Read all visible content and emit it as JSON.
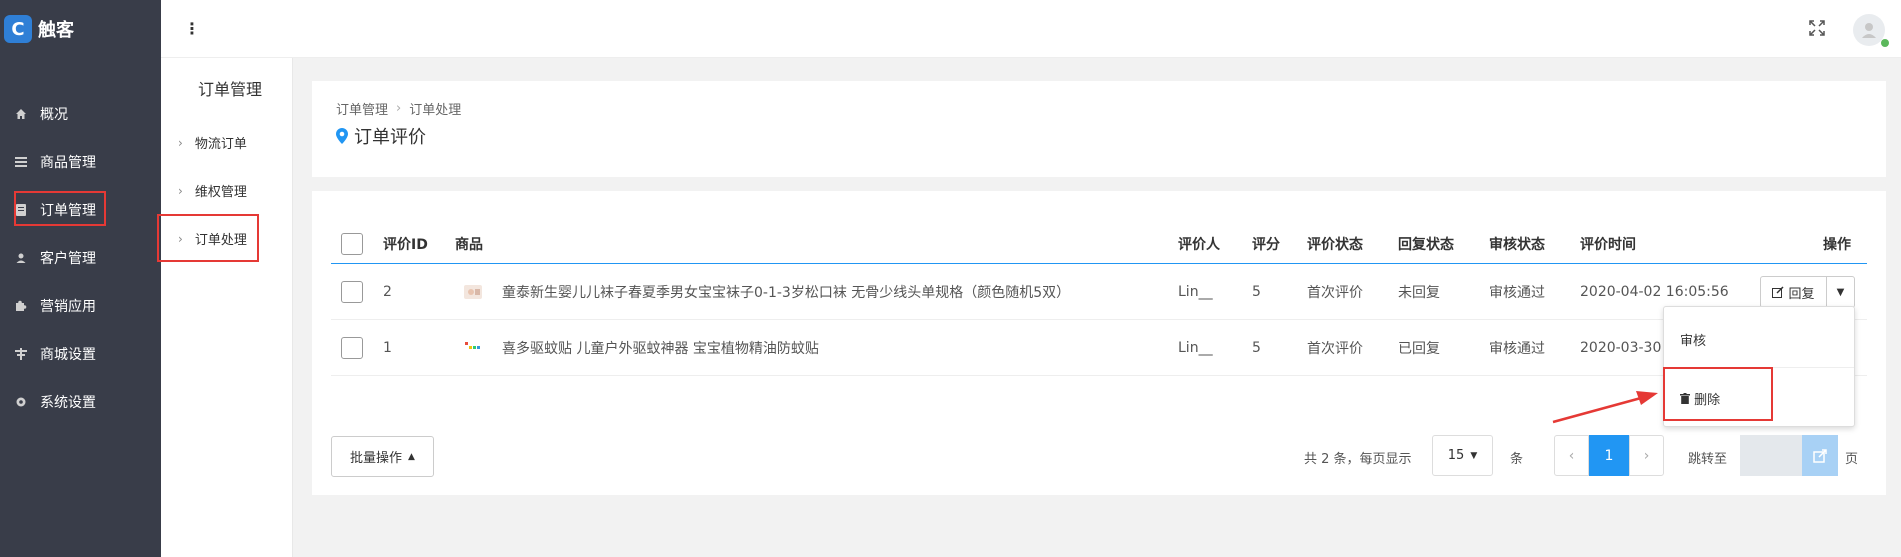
{
  "app": {
    "logo_text": "触客",
    "logo_mark": "C"
  },
  "colors": {
    "sidebar_bg": "#393d49",
    "accent": "#2196f3",
    "highlight": "#e53935"
  },
  "sidebar": {
    "items": [
      {
        "label": "概况",
        "icon": "home-icon"
      },
      {
        "label": "商品管理",
        "icon": "list-icon"
      },
      {
        "label": "订单管理",
        "icon": "document-icon"
      },
      {
        "label": "客户管理",
        "icon": "user-icon"
      },
      {
        "label": "营销应用",
        "icon": "puzzle-icon"
      },
      {
        "label": "商城设置",
        "icon": "shop-icon"
      },
      {
        "label": "系统设置",
        "icon": "gear-icon"
      }
    ]
  },
  "subsidebar": {
    "title": "订单管理",
    "items": [
      {
        "label": "物流订单"
      },
      {
        "label": "维权管理"
      },
      {
        "label": "订单处理"
      }
    ]
  },
  "breadcrumb": {
    "root": "订单管理",
    "current": "订单处理"
  },
  "page_title": "订单评价",
  "table": {
    "headers": {
      "id": "评价ID",
      "product": "商品",
      "reviewer": "评价人",
      "score": "评分",
      "review_status": "评价状态",
      "reply_status": "回复状态",
      "audit_status": "审核状态",
      "time": "评价时间",
      "action": "操作"
    },
    "rows": [
      {
        "id": "2",
        "product": "童泰新生婴儿儿袜子春夏季男女宝宝袜子0-1-3岁松口袜 无骨少线头单规格（颜色随机5双）",
        "reviewer": "Lin__",
        "score": "5",
        "review_status": "首次评价",
        "reply_status": "未回复",
        "audit_status": "审核通过",
        "time": "2020-04-02 16:05:56"
      },
      {
        "id": "1",
        "product": "喜多驱蚊贴 儿童户外驱蚊神器 宝宝植物精油防蚊贴",
        "reviewer": "Lin__",
        "score": "5",
        "review_status": "首次评价",
        "reply_status": "已回复",
        "audit_status": "审核通过",
        "time": "2020-03-30"
      }
    ],
    "reply_button": "回复"
  },
  "dropdown": {
    "audit": "审核",
    "delete": "删除"
  },
  "footer": {
    "batch_label": "批量操作",
    "total_text": "共 2 条，每页显示",
    "per_page": "15",
    "unit": "条",
    "current_page": "1",
    "goto_label": "跳转至",
    "page_suffix": "页"
  }
}
